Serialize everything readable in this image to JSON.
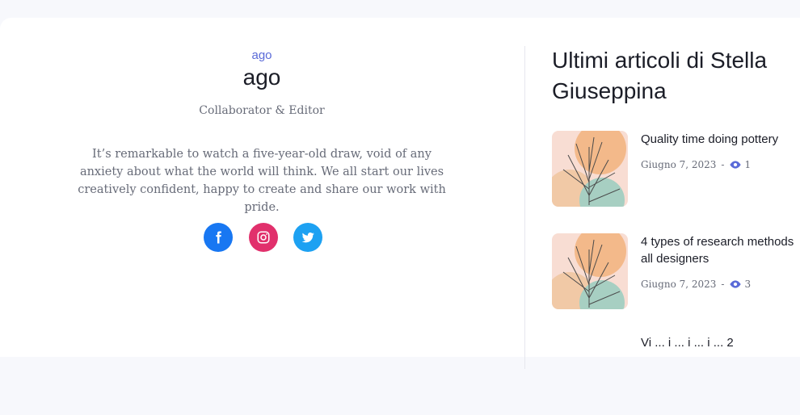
{
  "author": {
    "role_link": "ago",
    "name": "ago",
    "job_title": "Collaborator & Editor",
    "bio": "It’s remarkable to watch a five-year-old draw, void of any anxiety about what the world will think. We all start our lives creatively confident, happy to create and share our work with pride.",
    "socials": [
      {
        "icon": "facebook-icon",
        "color": "#1877f2"
      },
      {
        "icon": "instagram-icon",
        "color": "#e1306c"
      },
      {
        "icon": "twitter-icon",
        "color": "#1da1f2"
      }
    ]
  },
  "sidebar": {
    "title": "Ultimi articoli di Stella Giuseppina",
    "posts": [
      {
        "title": "Quality time doing pottery",
        "date": "Giugno 7, 2023",
        "separator": "-",
        "views": "1"
      },
      {
        "title": "4 types of research methods all designers",
        "date": "Giugno 7, 2023",
        "separator": "-",
        "views": "3"
      },
      {
        "title": "Vi ... i ... i ... i ... 2",
        "date": "",
        "separator": "",
        "views": ""
      }
    ]
  },
  "colors": {
    "accent": "#5a6ad8",
    "heading": "#1b1d27",
    "muted": "#676b78"
  }
}
